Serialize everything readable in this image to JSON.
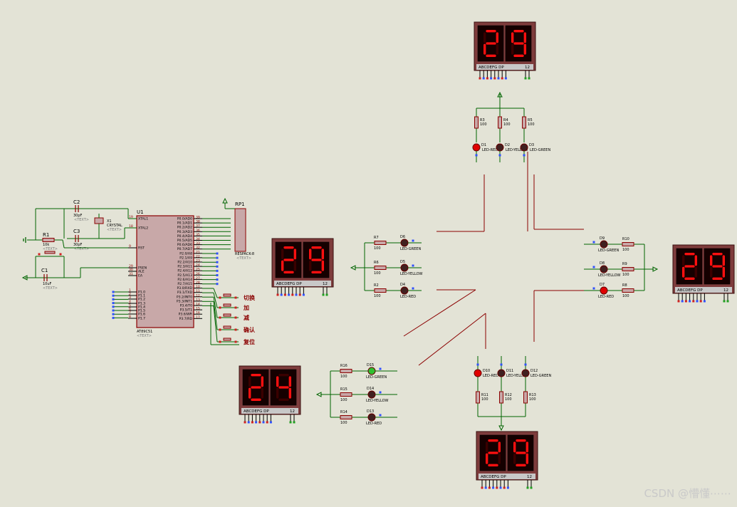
{
  "watermark": "CSDN @懵懂⋯⋯",
  "colors": {
    "background": "#e3e3d6",
    "wire": "#006400",
    "component": "#8b0000",
    "body_fill": "#c8a8a8",
    "display_frame": "#7e3c3c",
    "segment_on": "#ff1010",
    "segment_off": "#3a0000",
    "road_line": "#8b0000"
  },
  "displays": [
    {
      "id": "north",
      "value": "29",
      "pins": "ABCDEFG DP",
      "common": "12"
    },
    {
      "id": "west",
      "value": "29",
      "pins": "ABCDEFG DP",
      "common": "12"
    },
    {
      "id": "east",
      "value": "29",
      "pins": "ABCDEFG DP",
      "common": "12"
    },
    {
      "id": "south",
      "value": "29",
      "pins": "ABCDEFG DP",
      "common": "12"
    },
    {
      "id": "bottom-left",
      "value": "24",
      "pins": "ABCDEFG DP",
      "common": "12"
    }
  ],
  "led_groups": {
    "north": {
      "resistors": [
        {
          "ref": "R3",
          "value": "100"
        },
        {
          "ref": "R4",
          "value": "100"
        },
        {
          "ref": "R5",
          "value": "100"
        }
      ],
      "leds": [
        {
          "ref": "D1",
          "type": "LED-RED",
          "lit": true
        },
        {
          "ref": "D2",
          "type": "LED-YELLOW",
          "lit": false
        },
        {
          "ref": "D3",
          "type": "LED-GREEN",
          "lit": false
        }
      ]
    },
    "west": {
      "resistors": [
        {
          "ref": "R7",
          "value": "100"
        },
        {
          "ref": "R6",
          "value": "100"
        },
        {
          "ref": "R2",
          "value": "100"
        }
      ],
      "leds": [
        {
          "ref": "D6",
          "type": "LED-GREEN",
          "lit": false
        },
        {
          "ref": "D5",
          "type": "LED-YELLOW",
          "lit": false
        },
        {
          "ref": "D4",
          "type": "LED-RED",
          "lit": false
        }
      ]
    },
    "east": {
      "resistors": [
        {
          "ref": "R10",
          "value": "100"
        },
        {
          "ref": "R9",
          "value": "100"
        },
        {
          "ref": "R8",
          "value": "100"
        }
      ],
      "leds": [
        {
          "ref": "D9",
          "type": "LED-GREEN",
          "lit": false
        },
        {
          "ref": "D8",
          "type": "LED-YELLOW",
          "lit": false
        },
        {
          "ref": "D7",
          "type": "LED-RED",
          "lit": true
        }
      ]
    },
    "south": {
      "resistors": [
        {
          "ref": "R11",
          "value": "100"
        },
        {
          "ref": "R12",
          "value": "100"
        },
        {
          "ref": "R13",
          "value": "100"
        }
      ],
      "leds": [
        {
          "ref": "D10",
          "type": "LED-RED",
          "lit": true
        },
        {
          "ref": "D11",
          "type": "LED-YELLOW",
          "lit": false
        },
        {
          "ref": "D12",
          "type": "LED-GREEN",
          "lit": false
        }
      ]
    },
    "bottom_left": {
      "resistors": [
        {
          "ref": "R16",
          "value": "100"
        },
        {
          "ref": "R15",
          "value": "100"
        },
        {
          "ref": "R14",
          "value": "100"
        }
      ],
      "leds": [
        {
          "ref": "D15",
          "type": "LED-GREEN",
          "lit": true
        },
        {
          "ref": "D14",
          "type": "LED-YELLOW",
          "lit": false
        },
        {
          "ref": "D13",
          "type": "LED-RED",
          "lit": false
        }
      ]
    }
  },
  "mcu": {
    "ref": "U1",
    "part": "AT89C51",
    "left_pins": [
      {
        "name": "XTAL1",
        "num": "19"
      },
      {
        "name": "XTAL2",
        "num": "18"
      },
      {
        "name": "RST",
        "num": "9"
      },
      {
        "name": "PSEN",
        "num": "29"
      },
      {
        "name": "ALE",
        "num": "30"
      },
      {
        "name": "EA",
        "num": "31"
      },
      {
        "name": "P1.0",
        "num": "1"
      },
      {
        "name": "P1.1",
        "num": "2"
      },
      {
        "name": "P1.2",
        "num": "3"
      },
      {
        "name": "P1.3",
        "num": "4"
      },
      {
        "name": "P1.4",
        "num": "5"
      },
      {
        "name": "P1.5",
        "num": "6"
      },
      {
        "name": "P1.6",
        "num": "7"
      },
      {
        "name": "P1.7",
        "num": "8"
      }
    ],
    "right_pins": [
      {
        "name": "P0.0/AD0",
        "num": "39"
      },
      {
        "name": "P0.1/AD1",
        "num": "38"
      },
      {
        "name": "P0.2/AD2",
        "num": "37"
      },
      {
        "name": "P0.3/AD3",
        "num": "36"
      },
      {
        "name": "P0.4/AD4",
        "num": "35"
      },
      {
        "name": "P0.5/AD5",
        "num": "34"
      },
      {
        "name": "P0.6/AD6",
        "num": "33"
      },
      {
        "name": "P0.7/AD7",
        "num": "32"
      },
      {
        "name": "P2.0/A8",
        "num": "21"
      },
      {
        "name": "P2.1/A9",
        "num": "22"
      },
      {
        "name": "P2.2/A10",
        "num": "23"
      },
      {
        "name": "P2.3/A11",
        "num": "24"
      },
      {
        "name": "P2.4/A12",
        "num": "25"
      },
      {
        "name": "P2.5/A13",
        "num": "26"
      },
      {
        "name": "P2.6/A14",
        "num": "27"
      },
      {
        "name": "P2.7/A15",
        "num": "28"
      },
      {
        "name": "P3.0/RXD",
        "num": "10"
      },
      {
        "name": "P3.1/TXD",
        "num": "11"
      },
      {
        "name": "P3.2/INT0",
        "num": "12"
      },
      {
        "name": "P3.3/INT1",
        "num": "13"
      },
      {
        "name": "P3.4/T0",
        "num": "14"
      },
      {
        "name": "P3.5/T1",
        "num": "15"
      },
      {
        "name": "P3.6/WR",
        "num": "16"
      },
      {
        "name": "P3.7/RD",
        "num": "17"
      }
    ]
  },
  "passives": {
    "c2": {
      "ref": "C2",
      "value": "30pF"
    },
    "c3": {
      "ref": "C3",
      "value": "30pF"
    },
    "x1": {
      "ref": "X1",
      "value": "CRYSTAL"
    },
    "r1": {
      "ref": "R1",
      "value": "10k"
    },
    "c1": {
      "ref": "C1",
      "value": "10uF"
    },
    "rp1": {
      "ref": "RP1",
      "value": "RESPACK-8"
    },
    "text_placeholder": "<TEXT>"
  },
  "switches": [
    {
      "label": "切换"
    },
    {
      "label": "加"
    },
    {
      "label": "减"
    },
    {
      "label": "确认"
    },
    {
      "label": "复位"
    }
  ]
}
